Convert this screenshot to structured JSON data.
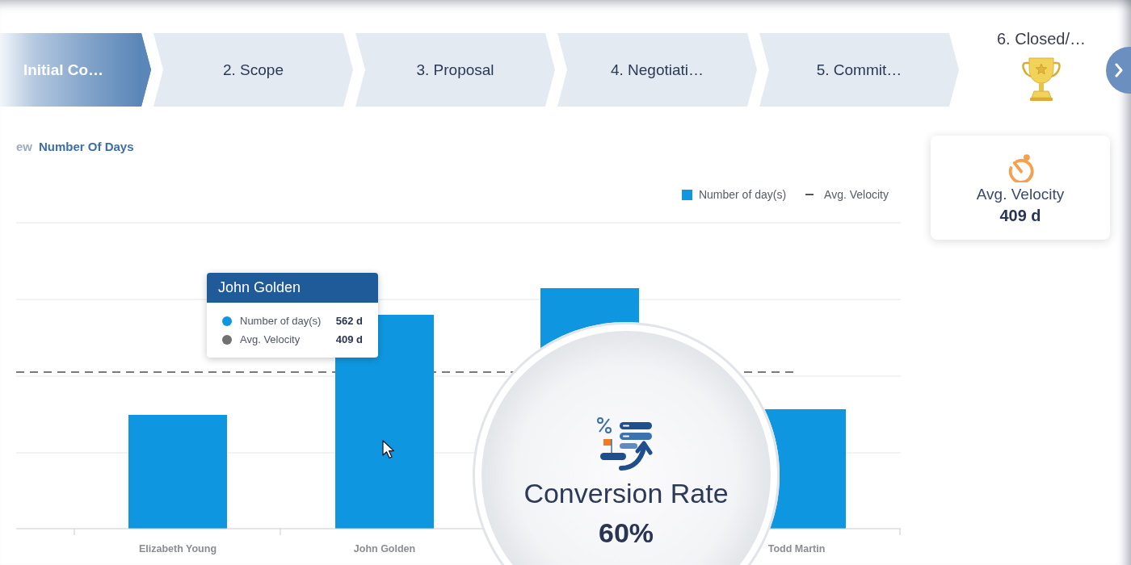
{
  "stages": [
    {
      "label": "Initial Co…",
      "selected": true
    },
    {
      "label": "2. Scope",
      "selected": false
    },
    {
      "label": "3. Proposal",
      "selected": false
    },
    {
      "label": "4. Negotiati…",
      "selected": false
    },
    {
      "label": "5. Commit…",
      "selected": false
    }
  ],
  "final_stage": {
    "label": "6. Closed/…"
  },
  "chart_panel": {
    "title_prefix": "ew",
    "title": "Number Of Days",
    "legend": [
      {
        "label": "Number of day(s)",
        "kind": "bar",
        "color": "#0e97e0"
      },
      {
        "label": "Avg. Velocity",
        "kind": "line",
        "color": "#555555"
      }
    ],
    "x_labels": [
      "Elizabeth Young",
      "John Golden",
      "Todd Martin"
    ],
    "tooltip": {
      "title": "John Golden",
      "rows": [
        {
          "label": "Number of day(s)",
          "value": "562 d",
          "color": "#0e97e0"
        },
        {
          "label": "Avg. Velocity",
          "value": "409 d",
          "color": "#707070"
        }
      ]
    }
  },
  "velocity_card": {
    "label": "Avg. Velocity",
    "value": "409 d"
  },
  "magnifier": {
    "label": "Conversion Rate",
    "value": "60%"
  }
}
